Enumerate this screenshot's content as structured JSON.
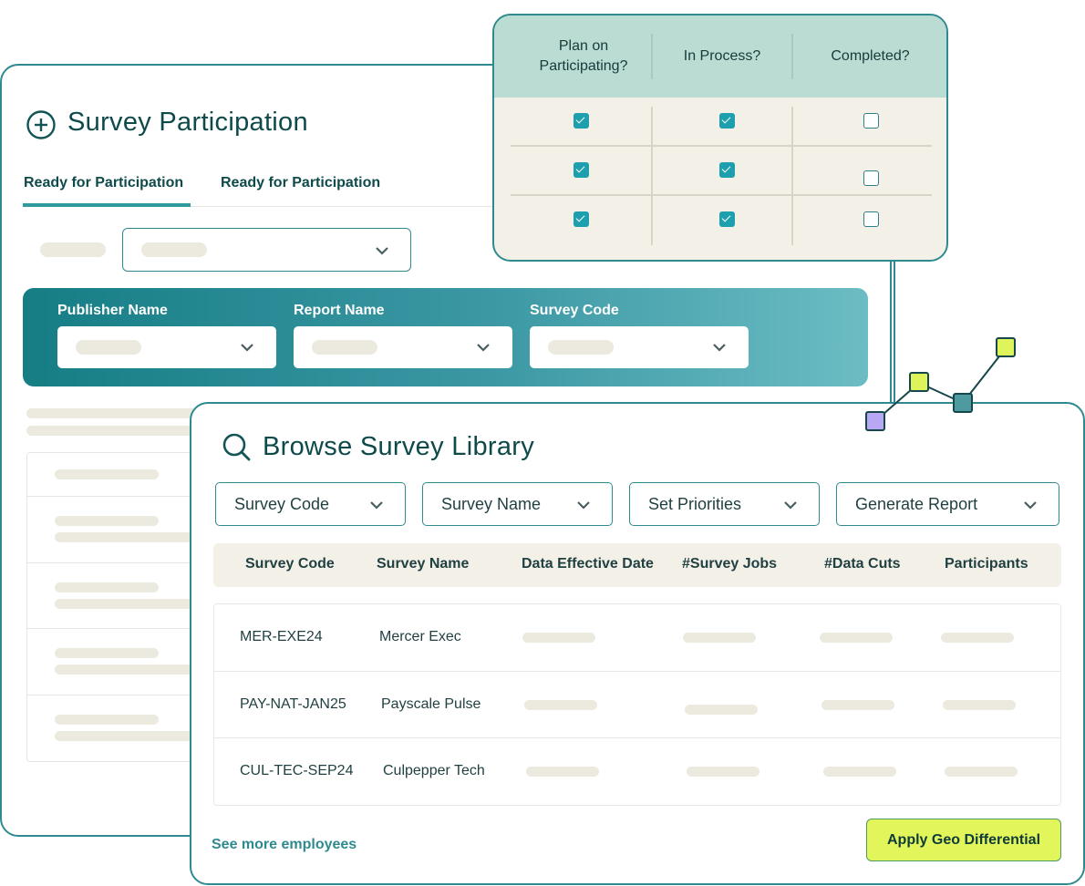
{
  "participation": {
    "title": "Survey Participation",
    "tabs": [
      {
        "label": "Ready for Participation",
        "active": true
      },
      {
        "label": "Ready for Participation",
        "active": false
      }
    ],
    "filters": {
      "labels": [
        "Publisher Name",
        "Report Name",
        "Survey Code"
      ]
    }
  },
  "checklist": {
    "headers": [
      "Plan on\nParticipating?",
      "In Process?",
      "Completed?"
    ],
    "rows": [
      [
        true,
        true,
        false
      ],
      [
        true,
        true,
        false
      ],
      [
        true,
        true,
        false
      ]
    ]
  },
  "library": {
    "title": "Browse Survey Library",
    "filters": [
      "Survey Code",
      "Survey Name",
      "Set Priorities",
      "Generate Report"
    ],
    "columns": [
      "Survey Code",
      "Survey Name",
      "Data Effective Date",
      "#Survey Jobs",
      "#Data Cuts",
      "Participants"
    ],
    "rows": [
      {
        "code": "MER-EXE24",
        "name": "Mercer Exec"
      },
      {
        "code": "PAY-NAT-JAN25",
        "name": "Payscale Pulse"
      },
      {
        "code": "CUL-TEC-SEP24",
        "name": "Culpepper Tech"
      }
    ],
    "see_more": "See more employees",
    "apply_button": "Apply Geo Differential"
  },
  "colors": {
    "accent": "#2f8a8f",
    "highlight": "#e2f55a",
    "check": "#1d9fae"
  },
  "icons": [
    "plus-circle-icon",
    "search-icon",
    "chevron-down-icon",
    "checkbox-icon"
  ]
}
